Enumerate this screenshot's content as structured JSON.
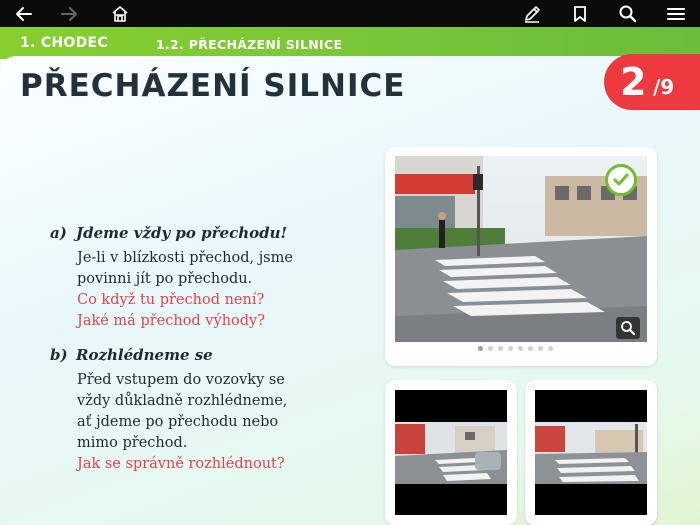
{
  "toolbar": {
    "back_icon": "arrow-left-icon",
    "forward_icon": "arrow-right-icon",
    "home_icon": "home-icon",
    "edit_icon": "pencil-icon",
    "bookmark_icon": "bookmark-icon",
    "search_icon": "search-icon",
    "menu_icon": "hamburger-menu-icon"
  },
  "breadcrumb": {
    "chapter": "1. CHODEC",
    "section": "1.2. PŘECHÁZENÍ SILNICE"
  },
  "page": {
    "title": "PŘECHÁZENÍ SILNICE",
    "current": "2",
    "separator_total": "/9"
  },
  "content": {
    "a": {
      "marker": "a)",
      "heading": "Jdeme vždy po přechodu!",
      "lines": [
        "Je-li v blízkosti přechod, jsme",
        "povinni jít po přechodu."
      ],
      "questions": [
        "Co když tu přechod není?",
        "Jaké má přechod výhody?"
      ]
    },
    "b": {
      "marker": "b)",
      "heading": "Rozhlédneme se",
      "lines": [
        "Před vstupem do vozovky se",
        "vždy důkladně rozhlédneme,",
        "ať jdeme po přechodu nebo",
        "mimo přechod."
      ],
      "questions": [
        "Jak se správně rozhlédnout?"
      ]
    }
  },
  "gallery": {
    "dot_count": 8,
    "active_dot": 0,
    "accent": "#6fbf2c",
    "badge_color": "#ee3a3f",
    "question_color": "#e2434a"
  }
}
